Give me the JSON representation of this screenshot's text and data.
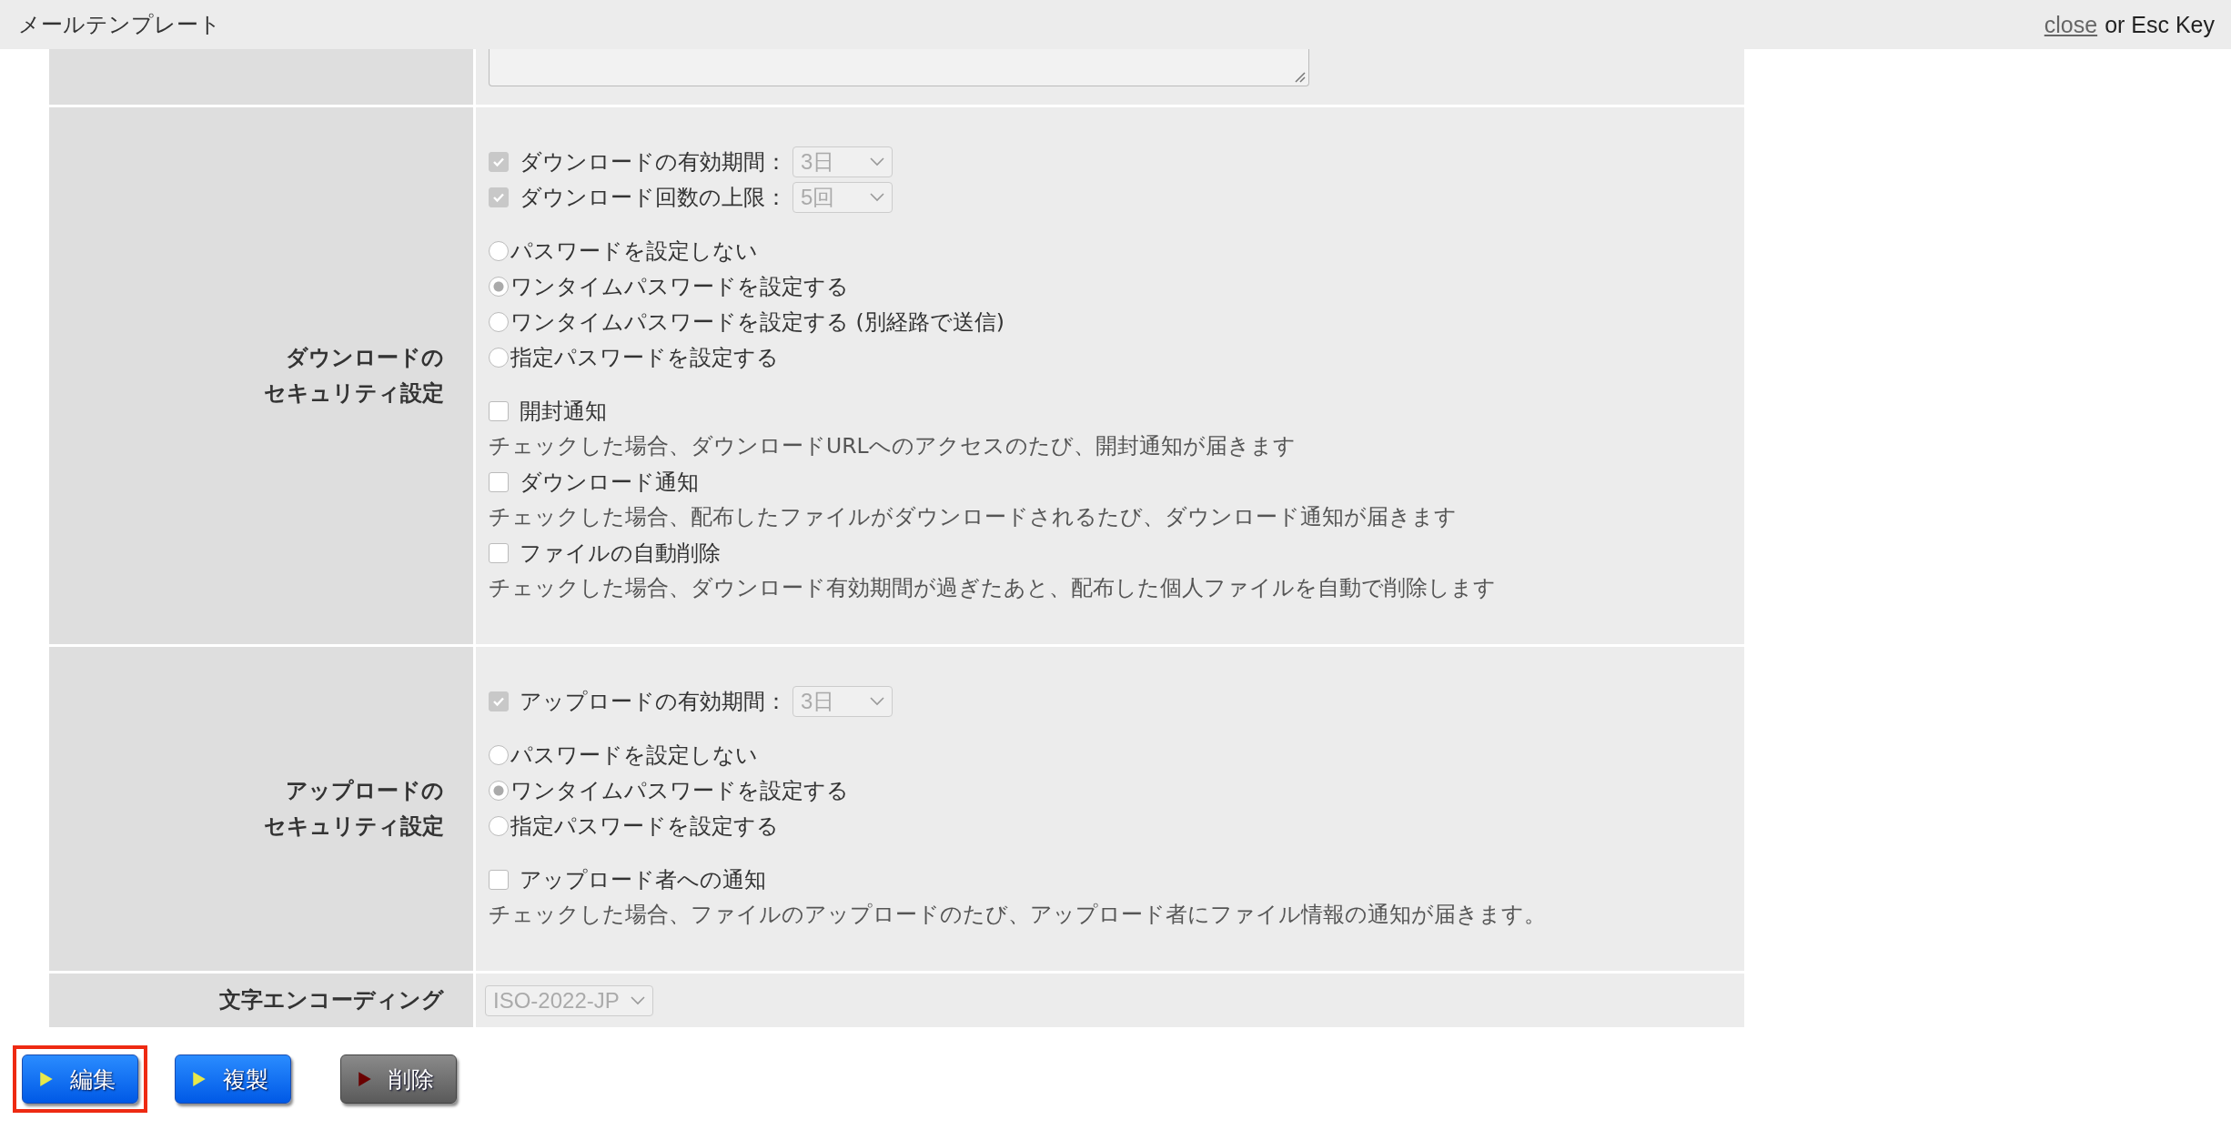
{
  "header": {
    "title": "メールテンプレート",
    "close_link": "close",
    "close_hint": "or Esc Key"
  },
  "download_security": {
    "label_lines": [
      "ダウンロードの",
      "セキュリティ設定"
    ],
    "limits": [
      {
        "label": "ダウンロードの有効期間：",
        "checked": true,
        "disabled": true,
        "value": "3日"
      },
      {
        "label": "ダウンロード回数の上限：",
        "checked": true,
        "disabled": true,
        "value": "5回"
      }
    ],
    "radios": [
      {
        "label": "パスワードを設定しない",
        "selected": false
      },
      {
        "label": "ワンタイムパスワードを設定する",
        "selected": true
      },
      {
        "label": "ワンタイムパスワードを設定する (別経路で送信)",
        "selected": false
      },
      {
        "label": "指定パスワードを設定する",
        "selected": false
      }
    ],
    "notices": [
      {
        "label": "開封通知",
        "checked": false,
        "description": "チェックした場合、ダウンロードURLへのアクセスのたび、開封通知が届きます"
      },
      {
        "label": "ダウンロード通知",
        "checked": false,
        "description": "チェックした場合、配布したファイルがダウンロードされるたび、ダウンロード通知が届きます"
      },
      {
        "label": "ファイルの自動削除",
        "checked": false,
        "description": "チェックした場合、ダウンロード有効期間が過ぎたあと、配布した個人ファイルを自動で削除します"
      }
    ]
  },
  "upload_security": {
    "label_lines": [
      "アップロードの",
      "セキュリティ設定"
    ],
    "limits": [
      {
        "label": "アップロードの有効期間：",
        "checked": true,
        "disabled": true,
        "value": "3日"
      }
    ],
    "radios": [
      {
        "label": "パスワードを設定しない",
        "selected": false
      },
      {
        "label": "ワンタイムパスワードを設定する",
        "selected": true
      },
      {
        "label": "指定パスワードを設定する",
        "selected": false
      }
    ],
    "notices": [
      {
        "label": "アップロード者への通知",
        "checked": false,
        "description": "チェックした場合、ファイルのアップロードのたび、アップロード者にファイル情報の通知が届きます。"
      }
    ]
  },
  "encoding": {
    "label": "文字エンコーディング",
    "value": "ISO-2022-JP"
  },
  "buttons": [
    {
      "label": "編集",
      "kind": "primary",
      "highlighted": true
    },
    {
      "label": "複製",
      "kind": "primary",
      "highlighted": false
    },
    {
      "label": "削除",
      "kind": "danger",
      "highlighted": false
    }
  ]
}
